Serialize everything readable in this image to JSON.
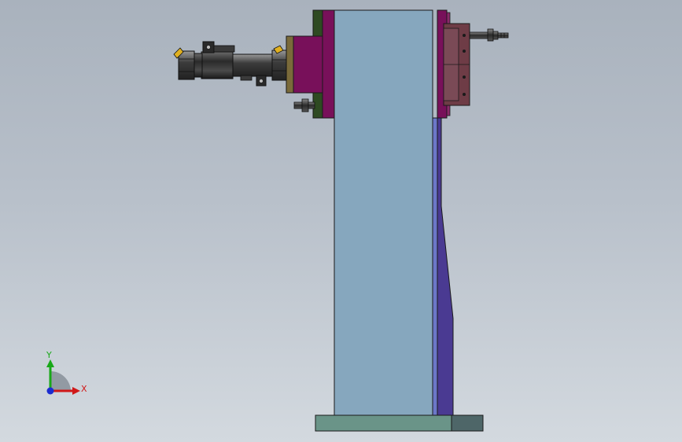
{
  "viewport": {
    "background_top": "#a9b2bd",
    "background_bottom": "#d3d9df"
  },
  "triad": {
    "x_label": "X",
    "y_label": "Y",
    "x_color": "#d01818",
    "y_color": "#18a818",
    "z_color": "#1c2cd0"
  },
  "model": {
    "column_color": "#86a7be",
    "flange_color": "#78105a",
    "gasket_color": "#2e4a22",
    "brace_color": "#4a3a92",
    "base_color": "#6a9488",
    "base_end_color": "#4e6668",
    "block_color": "#6e3c46",
    "cylinder_color": "#3a3a3a",
    "accent_color": "#e0b020"
  }
}
